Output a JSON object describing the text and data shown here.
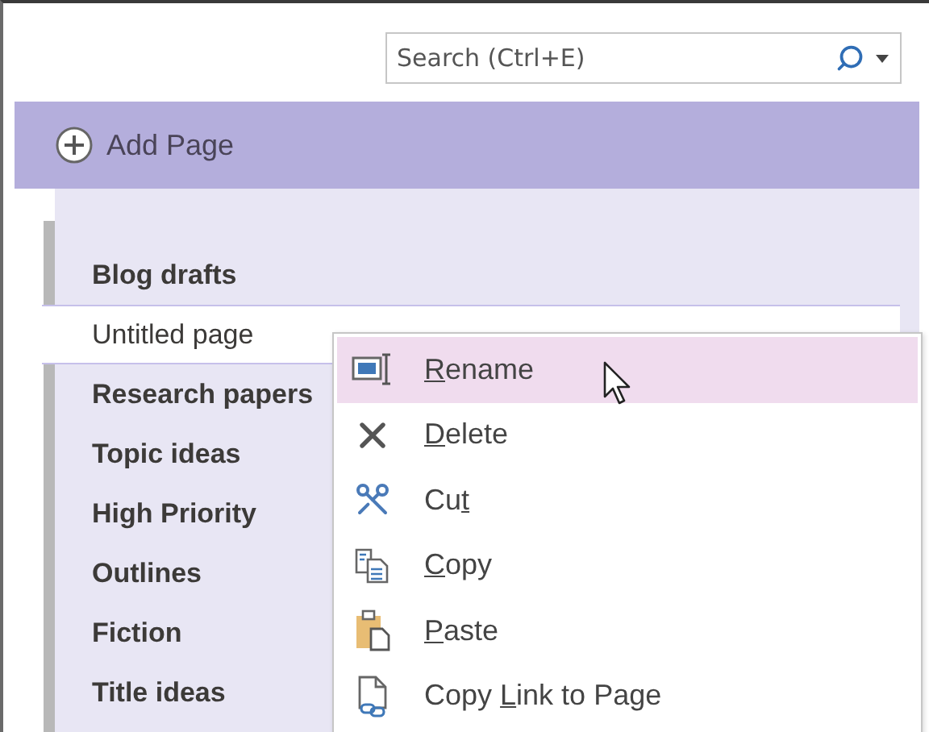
{
  "search": {
    "placeholder": "Search (Ctrl+E)"
  },
  "add_page": {
    "label": "Add Page"
  },
  "pages": [
    {
      "title": "Blog drafts",
      "selected": false
    },
    {
      "title": "Untitled page",
      "selected": true
    },
    {
      "title": "Research papers",
      "selected": false
    },
    {
      "title": "Topic ideas",
      "selected": false
    },
    {
      "title": "High Priority",
      "selected": false
    },
    {
      "title": "Outlines",
      "selected": false
    },
    {
      "title": "Fiction",
      "selected": false
    },
    {
      "title": "Title ideas",
      "selected": false
    }
  ],
  "context_menu": {
    "items": [
      {
        "kind": "rename",
        "key": "R",
        "post": "ename",
        "selected": true
      },
      {
        "kind": "delete",
        "key": "D",
        "post": "elete",
        "selected": false
      },
      {
        "kind": "cut",
        "pre": "Cu",
        "key": "t",
        "selected": false
      },
      {
        "kind": "copy",
        "key": "C",
        "post": "opy",
        "selected": false
      },
      {
        "kind": "paste",
        "key": "P",
        "post": "aste",
        "selected": false
      },
      {
        "kind": "link",
        "pre": "Copy ",
        "key": "L",
        "post": "ink to Page",
        "selected": false
      }
    ]
  }
}
